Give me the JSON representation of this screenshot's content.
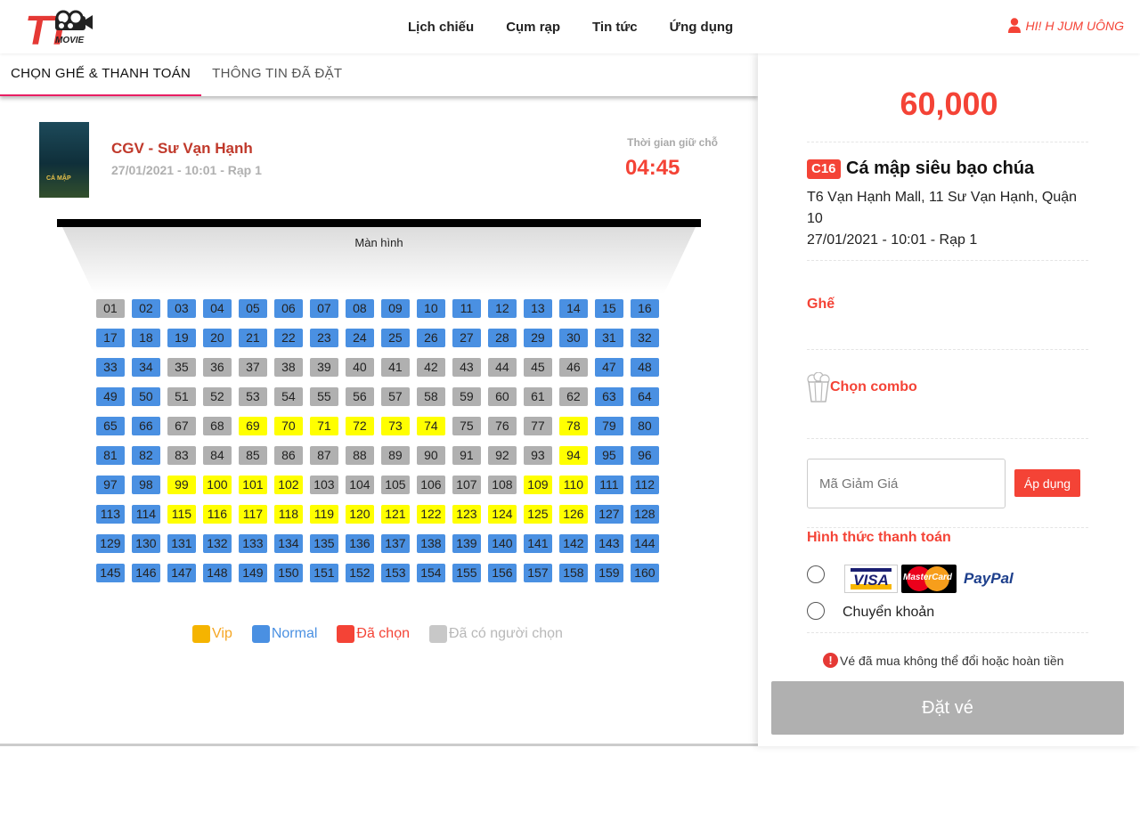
{
  "header": {
    "logo_text": "TT MOVIE",
    "nav": [
      "Lịch chiếu",
      "Cụm rạp",
      "Tin tức",
      "Ứng dụng"
    ],
    "user_greeting": "HI! H JUM UÔNG"
  },
  "tabs": [
    {
      "label": "CHỌN GHẾ & THANH TOÁN",
      "active": true
    },
    {
      "label": "THÔNG TIN ĐÃ ĐẶT",
      "active": false
    }
  ],
  "show": {
    "cinema": "CGV - Sư Vạn Hạnh",
    "datetime": "27/01/2021 - 10:01 - Rạp 1",
    "hold_label": "Thời gian giữ chỗ",
    "hold_timer": "04:45"
  },
  "screen_label": "Màn hình",
  "seats": [
    [
      [
        "01",
        "taken"
      ],
      [
        "02",
        "normal"
      ],
      [
        "03",
        "normal"
      ],
      [
        "04",
        "normal"
      ],
      [
        "05",
        "normal"
      ],
      [
        "06",
        "normal"
      ],
      [
        "07",
        "normal"
      ],
      [
        "08",
        "normal"
      ],
      [
        "09",
        "normal"
      ],
      [
        "10",
        "normal"
      ],
      [
        "11",
        "normal"
      ],
      [
        "12",
        "normal"
      ],
      [
        "13",
        "normal"
      ],
      [
        "14",
        "normal"
      ],
      [
        "15",
        "normal"
      ],
      [
        "16",
        "normal"
      ]
    ],
    [
      [
        "17",
        "normal"
      ],
      [
        "18",
        "normal"
      ],
      [
        "19",
        "normal"
      ],
      [
        "20",
        "normal"
      ],
      [
        "21",
        "normal"
      ],
      [
        "22",
        "normal"
      ],
      [
        "23",
        "normal"
      ],
      [
        "24",
        "normal"
      ],
      [
        "25",
        "normal"
      ],
      [
        "26",
        "normal"
      ],
      [
        "27",
        "normal"
      ],
      [
        "28",
        "normal"
      ],
      [
        "29",
        "normal"
      ],
      [
        "30",
        "normal"
      ],
      [
        "31",
        "normal"
      ],
      [
        "32",
        "normal"
      ]
    ],
    [
      [
        "33",
        "normal"
      ],
      [
        "34",
        "normal"
      ],
      [
        "35",
        "taken"
      ],
      [
        "36",
        "taken"
      ],
      [
        "37",
        "taken"
      ],
      [
        "38",
        "taken"
      ],
      [
        "39",
        "taken"
      ],
      [
        "40",
        "taken"
      ],
      [
        "41",
        "taken"
      ],
      [
        "42",
        "taken"
      ],
      [
        "43",
        "taken"
      ],
      [
        "44",
        "taken"
      ],
      [
        "45",
        "taken"
      ],
      [
        "46",
        "taken"
      ],
      [
        "47",
        "normal"
      ],
      [
        "48",
        "normal"
      ]
    ],
    [
      [
        "49",
        "normal"
      ],
      [
        "50",
        "normal"
      ],
      [
        "51",
        "taken"
      ],
      [
        "52",
        "taken"
      ],
      [
        "53",
        "taken"
      ],
      [
        "54",
        "taken"
      ],
      [
        "55",
        "taken"
      ],
      [
        "56",
        "taken"
      ],
      [
        "57",
        "taken"
      ],
      [
        "58",
        "taken"
      ],
      [
        "59",
        "taken"
      ],
      [
        "60",
        "taken"
      ],
      [
        "61",
        "taken"
      ],
      [
        "62",
        "taken"
      ],
      [
        "63",
        "normal"
      ],
      [
        "64",
        "normal"
      ]
    ],
    [
      [
        "65",
        "normal"
      ],
      [
        "66",
        "normal"
      ],
      [
        "67",
        "taken"
      ],
      [
        "68",
        "taken"
      ],
      [
        "69",
        "vip"
      ],
      [
        "70",
        "vip"
      ],
      [
        "71",
        "vip"
      ],
      [
        "72",
        "vip"
      ],
      [
        "73",
        "vip"
      ],
      [
        "74",
        "vip"
      ],
      [
        "75",
        "taken"
      ],
      [
        "76",
        "taken"
      ],
      [
        "77",
        "taken"
      ],
      [
        "78",
        "vip"
      ],
      [
        "79",
        "normal"
      ],
      [
        "80",
        "normal"
      ]
    ],
    [
      [
        "81",
        "normal"
      ],
      [
        "82",
        "normal"
      ],
      [
        "83",
        "taken"
      ],
      [
        "84",
        "taken"
      ],
      [
        "85",
        "taken"
      ],
      [
        "86",
        "taken"
      ],
      [
        "87",
        "taken"
      ],
      [
        "88",
        "taken"
      ],
      [
        "89",
        "taken"
      ],
      [
        "90",
        "taken"
      ],
      [
        "91",
        "taken"
      ],
      [
        "92",
        "taken"
      ],
      [
        "93",
        "taken"
      ],
      [
        "94",
        "vip"
      ],
      [
        "95",
        "normal"
      ],
      [
        "96",
        "normal"
      ]
    ],
    [
      [
        "97",
        "normal"
      ],
      [
        "98",
        "normal"
      ],
      [
        "99",
        "vip"
      ],
      [
        "100",
        "vip"
      ],
      [
        "101",
        "vip"
      ],
      [
        "102",
        "vip"
      ],
      [
        "103",
        "taken"
      ],
      [
        "104",
        "taken"
      ],
      [
        "105",
        "taken"
      ],
      [
        "106",
        "taken"
      ],
      [
        "107",
        "taken"
      ],
      [
        "108",
        "taken"
      ],
      [
        "109",
        "vip"
      ],
      [
        "110",
        "vip"
      ],
      [
        "111",
        "normal"
      ],
      [
        "112",
        "normal"
      ]
    ],
    [
      [
        "113",
        "normal"
      ],
      [
        "114",
        "normal"
      ],
      [
        "115",
        "vip"
      ],
      [
        "116",
        "vip"
      ],
      [
        "117",
        "vip"
      ],
      [
        "118",
        "vip"
      ],
      [
        "119",
        "vip"
      ],
      [
        "120",
        "vip"
      ],
      [
        "121",
        "vip"
      ],
      [
        "122",
        "vip"
      ],
      [
        "123",
        "vip"
      ],
      [
        "124",
        "vip"
      ],
      [
        "125",
        "vip"
      ],
      [
        "126",
        "vip"
      ],
      [
        "127",
        "normal"
      ],
      [
        "128",
        "normal"
      ]
    ],
    [
      [
        "129",
        "normal"
      ],
      [
        "130",
        "normal"
      ],
      [
        "131",
        "normal"
      ],
      [
        "132",
        "normal"
      ],
      [
        "133",
        "normal"
      ],
      [
        "134",
        "normal"
      ],
      [
        "135",
        "normal"
      ],
      [
        "136",
        "normal"
      ],
      [
        "137",
        "normal"
      ],
      [
        "138",
        "normal"
      ],
      [
        "139",
        "normal"
      ],
      [
        "140",
        "normal"
      ],
      [
        "141",
        "normal"
      ],
      [
        "142",
        "normal"
      ],
      [
        "143",
        "normal"
      ],
      [
        "144",
        "normal"
      ]
    ],
    [
      [
        "145",
        "normal"
      ],
      [
        "146",
        "normal"
      ],
      [
        "147",
        "normal"
      ],
      [
        "148",
        "normal"
      ],
      [
        "149",
        "normal"
      ],
      [
        "150",
        "normal"
      ],
      [
        "151",
        "normal"
      ],
      [
        "152",
        "normal"
      ],
      [
        "153",
        "normal"
      ],
      [
        "154",
        "normal"
      ],
      [
        "155",
        "normal"
      ],
      [
        "156",
        "normal"
      ],
      [
        "157",
        "normal"
      ],
      [
        "158",
        "normal"
      ],
      [
        "159",
        "normal"
      ],
      [
        "160",
        "normal"
      ]
    ]
  ],
  "legend": [
    {
      "label": "Vip",
      "color": "#f5b400",
      "text_color": "#f5a623"
    },
    {
      "label": "Normal",
      "color": "#4a90e2",
      "text_color": "#4a90e2"
    },
    {
      "label": "Đã chọn",
      "color": "#f44336",
      "text_color": "#f44336"
    },
    {
      "label": "Đã có người chọn",
      "color": "#c8c8c8",
      "text_color": "#b8b8b8"
    }
  ],
  "summary": {
    "price": "60,000",
    "age_rating": "C16",
    "movie_title": "Cá mập siêu bạo chúa",
    "address": "T6 Vạn Hạnh Mall, 11 Sư Vạn Hạnh, Quận 10",
    "datetime": "27/01/2021 - 10:01 - Rạp 1",
    "seat_label": "Ghế",
    "combo_label": "Chọn combo",
    "coupon_placeholder": "Mã Giảm Giá",
    "apply_label": "Áp dụng",
    "payment_label": "Hình thức thanh toán",
    "payment_options": [
      "VISA / MasterCard / PayPal",
      "Chuyển khoản"
    ],
    "card_labels": {
      "visa": "VISA",
      "mastercard": "MasterCard",
      "paypal": "PayPal"
    },
    "warning": "Vé đã mua không thể đổi hoặc hoàn tiền",
    "book_label": "Đặt vé"
  },
  "colors": {
    "accent": "#f44336",
    "normal": "#4a90e2",
    "vip": "#ffff00",
    "taken": "#b0b0b0"
  }
}
